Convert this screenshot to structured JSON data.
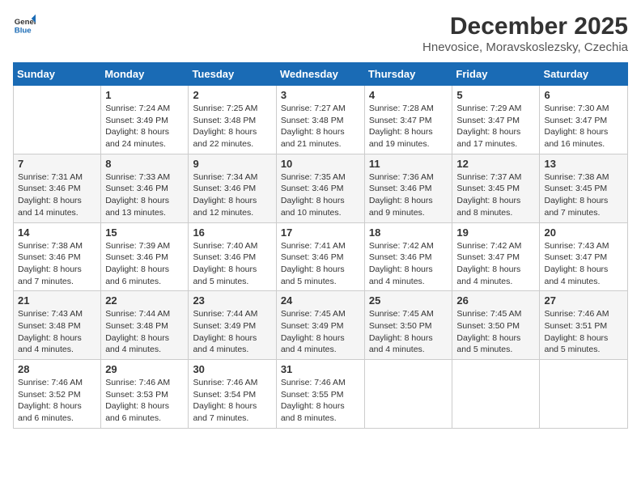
{
  "logo": {
    "line1": "General",
    "line2": "Blue"
  },
  "title": "December 2025",
  "location": "Hnevosice, Moravskoslezsky, Czechia",
  "days_of_week": [
    "Sunday",
    "Monday",
    "Tuesday",
    "Wednesday",
    "Thursday",
    "Friday",
    "Saturday"
  ],
  "weeks": [
    [
      {
        "day": "",
        "info": ""
      },
      {
        "day": "1",
        "info": "Sunrise: 7:24 AM\nSunset: 3:49 PM\nDaylight: 8 hours\nand 24 minutes."
      },
      {
        "day": "2",
        "info": "Sunrise: 7:25 AM\nSunset: 3:48 PM\nDaylight: 8 hours\nand 22 minutes."
      },
      {
        "day": "3",
        "info": "Sunrise: 7:27 AM\nSunset: 3:48 PM\nDaylight: 8 hours\nand 21 minutes."
      },
      {
        "day": "4",
        "info": "Sunrise: 7:28 AM\nSunset: 3:47 PM\nDaylight: 8 hours\nand 19 minutes."
      },
      {
        "day": "5",
        "info": "Sunrise: 7:29 AM\nSunset: 3:47 PM\nDaylight: 8 hours\nand 17 minutes."
      },
      {
        "day": "6",
        "info": "Sunrise: 7:30 AM\nSunset: 3:47 PM\nDaylight: 8 hours\nand 16 minutes."
      }
    ],
    [
      {
        "day": "7",
        "info": "Sunrise: 7:31 AM\nSunset: 3:46 PM\nDaylight: 8 hours\nand 14 minutes."
      },
      {
        "day": "8",
        "info": "Sunrise: 7:33 AM\nSunset: 3:46 PM\nDaylight: 8 hours\nand 13 minutes."
      },
      {
        "day": "9",
        "info": "Sunrise: 7:34 AM\nSunset: 3:46 PM\nDaylight: 8 hours\nand 12 minutes."
      },
      {
        "day": "10",
        "info": "Sunrise: 7:35 AM\nSunset: 3:46 PM\nDaylight: 8 hours\nand 10 minutes."
      },
      {
        "day": "11",
        "info": "Sunrise: 7:36 AM\nSunset: 3:46 PM\nDaylight: 8 hours\nand 9 minutes."
      },
      {
        "day": "12",
        "info": "Sunrise: 7:37 AM\nSunset: 3:45 PM\nDaylight: 8 hours\nand 8 minutes."
      },
      {
        "day": "13",
        "info": "Sunrise: 7:38 AM\nSunset: 3:45 PM\nDaylight: 8 hours\nand 7 minutes."
      }
    ],
    [
      {
        "day": "14",
        "info": "Sunrise: 7:38 AM\nSunset: 3:46 PM\nDaylight: 8 hours\nand 7 minutes."
      },
      {
        "day": "15",
        "info": "Sunrise: 7:39 AM\nSunset: 3:46 PM\nDaylight: 8 hours\nand 6 minutes."
      },
      {
        "day": "16",
        "info": "Sunrise: 7:40 AM\nSunset: 3:46 PM\nDaylight: 8 hours\nand 5 minutes."
      },
      {
        "day": "17",
        "info": "Sunrise: 7:41 AM\nSunset: 3:46 PM\nDaylight: 8 hours\nand 5 minutes."
      },
      {
        "day": "18",
        "info": "Sunrise: 7:42 AM\nSunset: 3:46 PM\nDaylight: 8 hours\nand 4 minutes."
      },
      {
        "day": "19",
        "info": "Sunrise: 7:42 AM\nSunset: 3:47 PM\nDaylight: 8 hours\nand 4 minutes."
      },
      {
        "day": "20",
        "info": "Sunrise: 7:43 AM\nSunset: 3:47 PM\nDaylight: 8 hours\nand 4 minutes."
      }
    ],
    [
      {
        "day": "21",
        "info": "Sunrise: 7:43 AM\nSunset: 3:48 PM\nDaylight: 8 hours\nand 4 minutes."
      },
      {
        "day": "22",
        "info": "Sunrise: 7:44 AM\nSunset: 3:48 PM\nDaylight: 8 hours\nand 4 minutes."
      },
      {
        "day": "23",
        "info": "Sunrise: 7:44 AM\nSunset: 3:49 PM\nDaylight: 8 hours\nand 4 minutes."
      },
      {
        "day": "24",
        "info": "Sunrise: 7:45 AM\nSunset: 3:49 PM\nDaylight: 8 hours\nand 4 minutes."
      },
      {
        "day": "25",
        "info": "Sunrise: 7:45 AM\nSunset: 3:50 PM\nDaylight: 8 hours\nand 4 minutes."
      },
      {
        "day": "26",
        "info": "Sunrise: 7:45 AM\nSunset: 3:50 PM\nDaylight: 8 hours\nand 5 minutes."
      },
      {
        "day": "27",
        "info": "Sunrise: 7:46 AM\nSunset: 3:51 PM\nDaylight: 8 hours\nand 5 minutes."
      }
    ],
    [
      {
        "day": "28",
        "info": "Sunrise: 7:46 AM\nSunset: 3:52 PM\nDaylight: 8 hours\nand 6 minutes."
      },
      {
        "day": "29",
        "info": "Sunrise: 7:46 AM\nSunset: 3:53 PM\nDaylight: 8 hours\nand 6 minutes."
      },
      {
        "day": "30",
        "info": "Sunrise: 7:46 AM\nSunset: 3:54 PM\nDaylight: 8 hours\nand 7 minutes."
      },
      {
        "day": "31",
        "info": "Sunrise: 7:46 AM\nSunset: 3:55 PM\nDaylight: 8 hours\nand 8 minutes."
      },
      {
        "day": "",
        "info": ""
      },
      {
        "day": "",
        "info": ""
      },
      {
        "day": "",
        "info": ""
      }
    ]
  ]
}
